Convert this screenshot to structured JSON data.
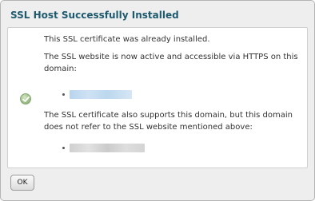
{
  "dialog": {
    "title": "SSL Host Successfully Installed",
    "message_installed": "This SSL certificate was already installed.",
    "message_active": "The SSL website is now active and accessible via HTTPS on this domain:",
    "message_also_supports": "The SSL certificate also supports this domain, but this domain does not refer to the SSL website mentioned above:",
    "status_icon": "success-check-icon",
    "ok_label": "OK"
  },
  "colors": {
    "title": "#1e5a6e",
    "dialog_bg": "#eeeeee",
    "content_bg": "#ffffff",
    "text": "#333333"
  }
}
